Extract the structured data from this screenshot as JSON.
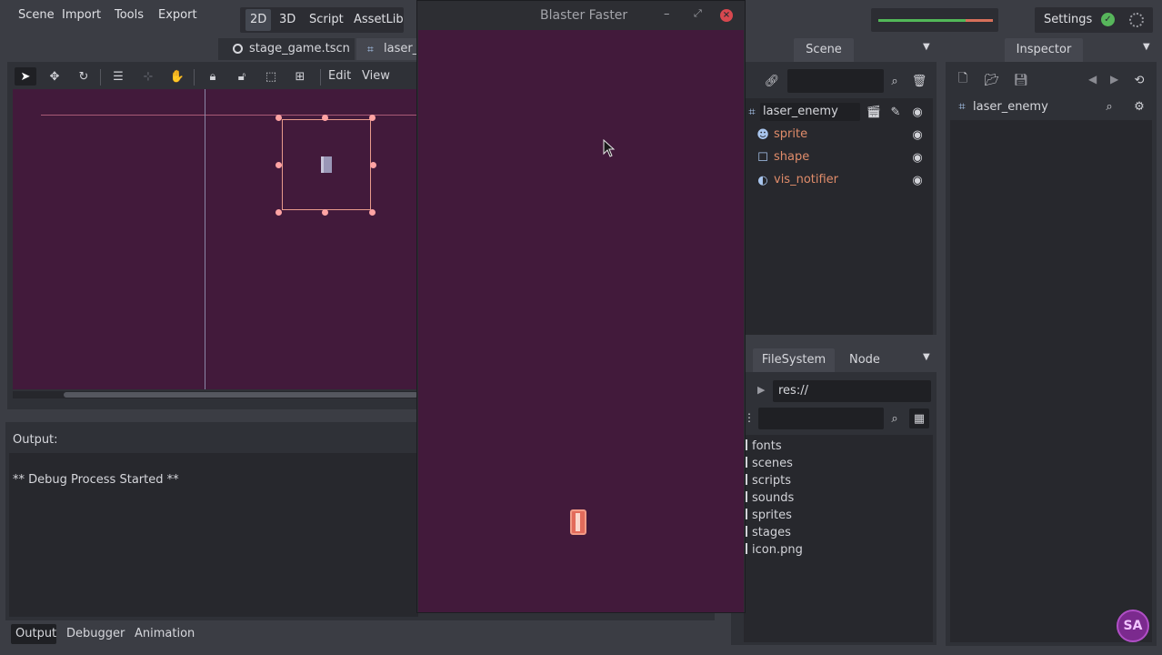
{
  "menu": [
    "Scene",
    "Import",
    "Tools",
    "Export"
  ],
  "modes": [
    "2D",
    "3D",
    "Script",
    "AssetLib"
  ],
  "settings_label": "Settings",
  "scene_tabs": [
    "stage_game.tscn",
    "laser_e"
  ],
  "toolbar": {
    "edit_label": "Edit",
    "view_label": "View"
  },
  "game_window": {
    "title": "Blaster Faster"
  },
  "scene_panel": {
    "tab": "Scene",
    "root": "laser_enemy",
    "children": [
      "sprite",
      "shape",
      "vis_notifier"
    ]
  },
  "inspector": {
    "tab": "Inspector",
    "object": "laser_enemy"
  },
  "filesystem": {
    "tabs": [
      "FileSystem",
      "Node"
    ],
    "path": "res://",
    "items": [
      "fonts",
      "scenes",
      "scripts",
      "sounds",
      "sprites",
      "stages",
      "icon.png"
    ]
  },
  "output": {
    "label": "Output:",
    "log": "** Debug Process Started **"
  },
  "bottom_tabs": [
    "Output",
    "Debugger",
    "Animation"
  ],
  "colors": {
    "viewport": "#421a3b",
    "node_name": "#e08c6a",
    "accent": "#699ce8",
    "selection": "#ffa3a3"
  }
}
